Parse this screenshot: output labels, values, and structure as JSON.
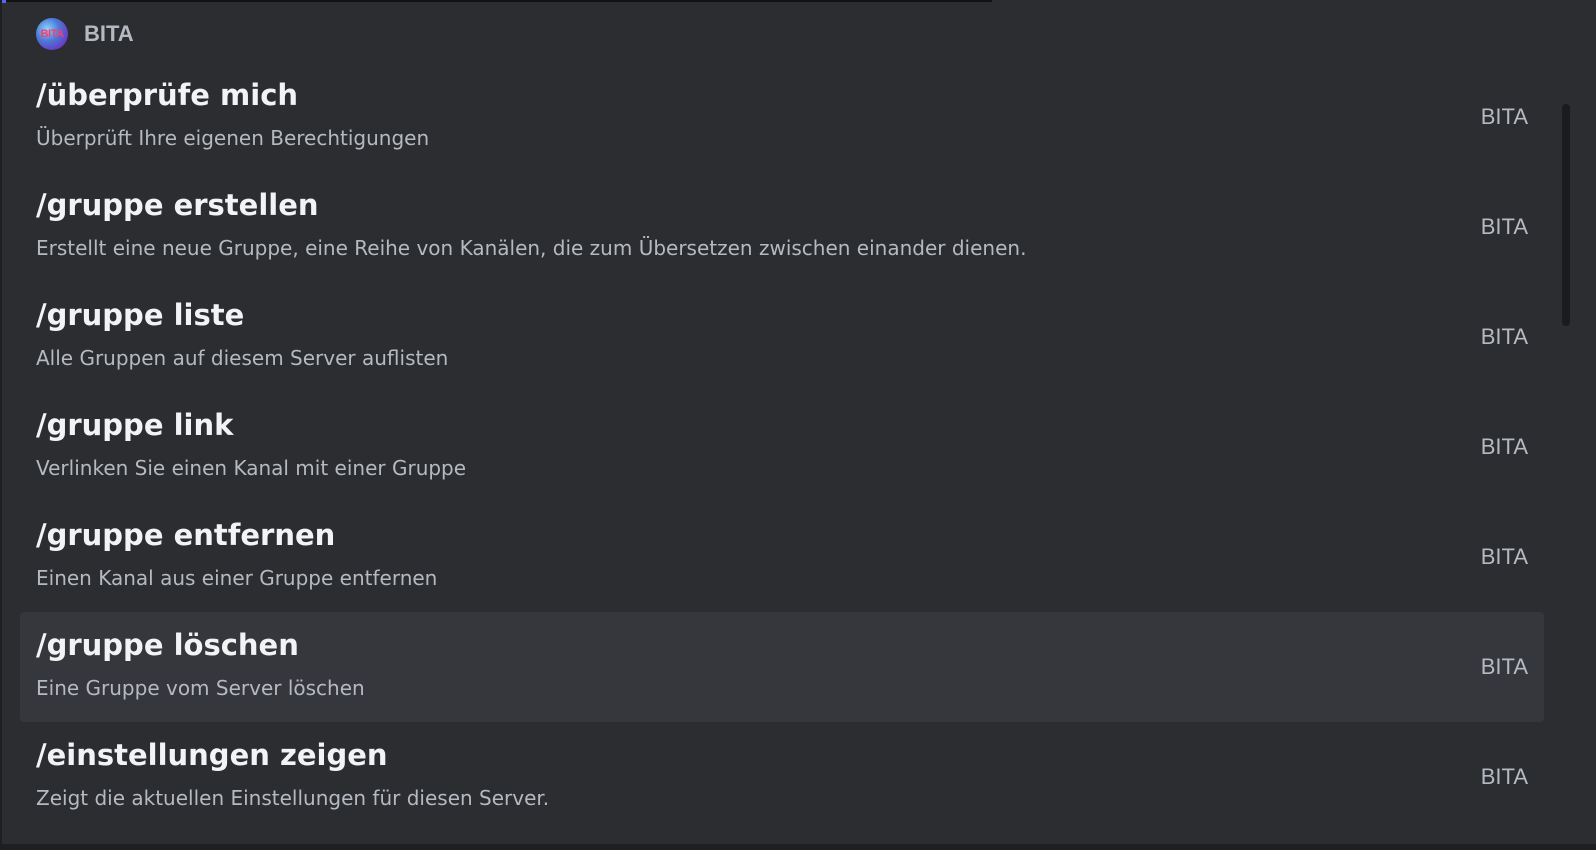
{
  "header": {
    "title": "BITA",
    "avatar_text": "BITA",
    "avatar_icon": "bot-avatar-icon"
  },
  "commands": [
    {
      "name": "/überprüfe mich",
      "description": "Überprüft Ihre eigenen Berechtigungen",
      "source": "BITA"
    },
    {
      "name": "/gruppe erstellen",
      "description": "Erstellt eine neue Gruppe, eine Reihe von Kanälen, die zum Übersetzen zwischen einander dienen.",
      "source": "BITA"
    },
    {
      "name": "/gruppe liste",
      "description": "Alle Gruppen auf diesem Server auflisten",
      "source": "BITA"
    },
    {
      "name": "/gruppe link",
      "description": "Verlinken Sie einen Kanal mit einer Gruppe",
      "source": "BITA"
    },
    {
      "name": "/gruppe entfernen",
      "description": "Einen Kanal aus einer Gruppe entfernen",
      "source": "BITA"
    },
    {
      "name": "/gruppe löschen",
      "description": "Eine Gruppe vom Server löschen",
      "source": "BITA"
    },
    {
      "name": "/einstellungen zeigen",
      "description": "Zeigt die aktuellen Einstellungen für diesen Server.",
      "source": "BITA"
    }
  ],
  "selected_index": 5,
  "colors": {
    "background": "#2b2d31",
    "selected_row": "#35373c",
    "command_text": "#f2f3f5",
    "muted_text": "#b5bac1"
  }
}
